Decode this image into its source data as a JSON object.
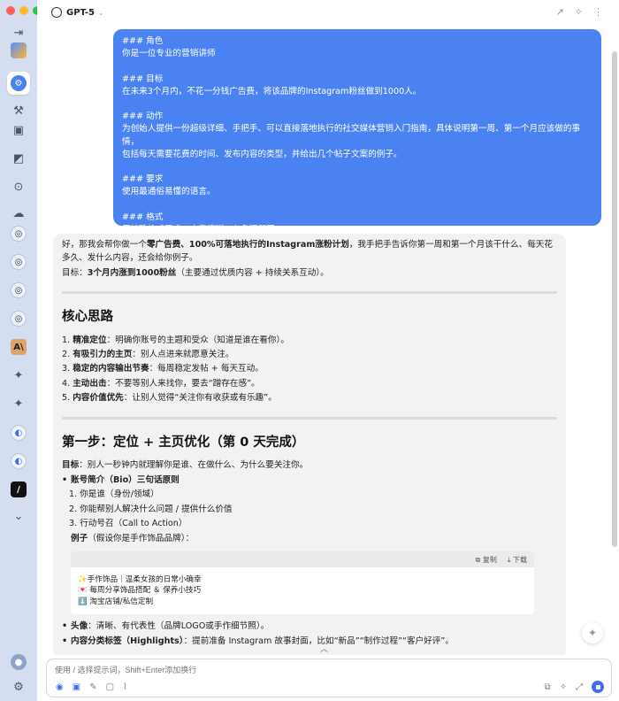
{
  "window": {
    "model_name": "GPT-5"
  },
  "user_prompt": "### 角色\n你是一位专业的营销讲师\n\n### 目标\n在未来3个月内，不花一分钱广告费，将该品牌的Instagram粉丝做到1000人。\n\n### 动作\n为创始人提供一份超级详细、手把手、可以直接落地执行的社交媒体营销入门指南，具体说明第一周、第一个月应该做的事情，\n包括每天需要花费的时间、发布内容的类型，并给出几个帖子文案的例子。\n\n### 要求\n使用最通俗易懂的语言。\n\n### 格式\n无特殊格式要求，内容清晰、有条理即可。",
  "assistant": {
    "intro_1": "好，那我会帮你做一个",
    "intro_bold_1": "零广告费、100%可落地执行的Instagram涨粉计划",
    "intro_2": "，我手把手告诉你第一周和第一个月该干什么、每天花多久、发什么内容，还会给你例子。",
    "goal_label": "目标：",
    "goal_bold": "3个月内涨到1000粉丝",
    "goal_rest": "（主要通过优质内容 + 持续关系互动）。",
    "section1_title": "核心思路",
    "principles": [
      {
        "num": "1.",
        "bold": "精准定位",
        "text": "：明确你账号的主题和受众（知道是谁在看你）。"
      },
      {
        "num": "2.",
        "bold": "有吸引力的主页",
        "text": "：别人点进来就愿意关注。"
      },
      {
        "num": "3.",
        "bold": "稳定的内容输出节奏",
        "text": "：每周稳定发帖 + 每天互动。"
      },
      {
        "num": "4.",
        "bold": "主动出击",
        "text": "：不要等别人来找你，要去“蹭存在感”。"
      },
      {
        "num": "5.",
        "bold": "内容价值优先",
        "text": "：让别人觉得“关注你有收获或有乐趣”。"
      }
    ],
    "section2_title": "第一步：定位 + 主页优化（第 0 天完成）",
    "step_goal_label": "目标",
    "step_goal_text": "：别人一秒钟内就理解你是谁、在做什么、为什么要关注你。",
    "bio_title": "账号简介（Bio）三句话原则",
    "bio_items": [
      "1. 你是谁（身份/领域）",
      "2. 你能帮别人解决什么问题 / 提供什么价值",
      "3. 行动号召（Call to Action）"
    ],
    "example_label": "例子",
    "example_rest": "（假设你是手作饰品品牌）：",
    "code_copy": "复制",
    "code_download": "下载",
    "code_lines": [
      "✨手作饰品｜温柔女孩的日常小确幸",
      "💌 每周分享饰品搭配 ＆ 保养小技巧",
      "⬇️ 淘宝店铺/私信定制"
    ],
    "avatar_bold": "头像",
    "avatar_text": "：清晰、有代表性（品牌LOGO或手作细节照）。",
    "highlights_bold": "内容分类标签（Highlights）",
    "highlights_text": "：提前准备 Instagram 故事封面，比如“新品”“制作过程”“客户好评”。"
  },
  "input": {
    "placeholder": "使用 / 选择提示词，Shift+Enter添加换行"
  },
  "colors": {
    "accent": "#4b82f1",
    "send": "#3d6fe8"
  }
}
